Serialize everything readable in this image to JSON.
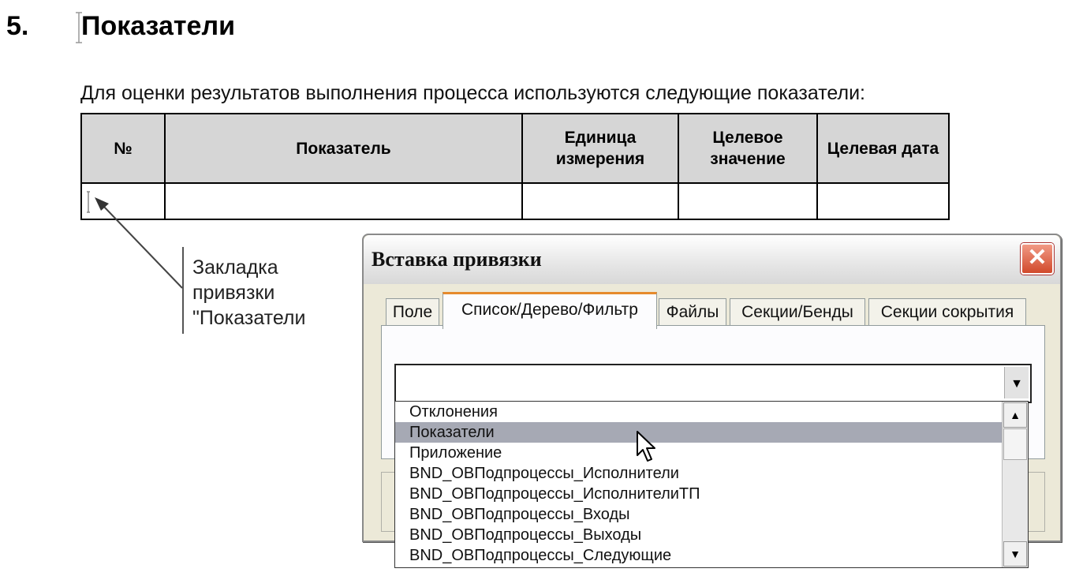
{
  "document": {
    "section_number": "5.",
    "section_title": "Показатели",
    "intro_text": "Для оценки результатов выполнения процесса используются следующие показатели:",
    "table": {
      "headers": [
        "№",
        "Показатель",
        "Единица измерения",
        "Целевое значение",
        "Целевая дата"
      ],
      "rows": [
        [
          "",
          "",
          "",
          "",
          ""
        ]
      ]
    },
    "callout": [
      "Закладка",
      "привязки",
      "\"Показатели"
    ]
  },
  "dialog": {
    "title": "Вставка привязки",
    "close_label": "✕",
    "tabs": [
      {
        "label": "Поле",
        "active": false
      },
      {
        "label": "Список/Дерево/Фильтр",
        "active": true
      },
      {
        "label": "Файлы",
        "active": false
      },
      {
        "label": "Секции/Бенды",
        "active": false
      },
      {
        "label": "Секции сокрытия",
        "active": false
      }
    ],
    "combo_value": "",
    "dropdown_items": [
      "Отклонения",
      "Показатели",
      "Приложение",
      "BND_ОВПодпроцессы_Исполнители",
      "BND_ОВПодпроцессы_ИсполнителиТП",
      "BND_ОВПодпроцессы_Входы",
      "BND_ОВПодпроцессы_Выходы",
      "BND_ОВПодпроцессы_Следующие"
    ],
    "selected_item": "Показатели",
    "icons": {
      "combo_arrow": "dropdown-arrow-icon",
      "scroll_up": "scroll-up-icon",
      "scroll_down": "scroll-down-icon",
      "cursor": "mouse-pointer-icon"
    }
  }
}
